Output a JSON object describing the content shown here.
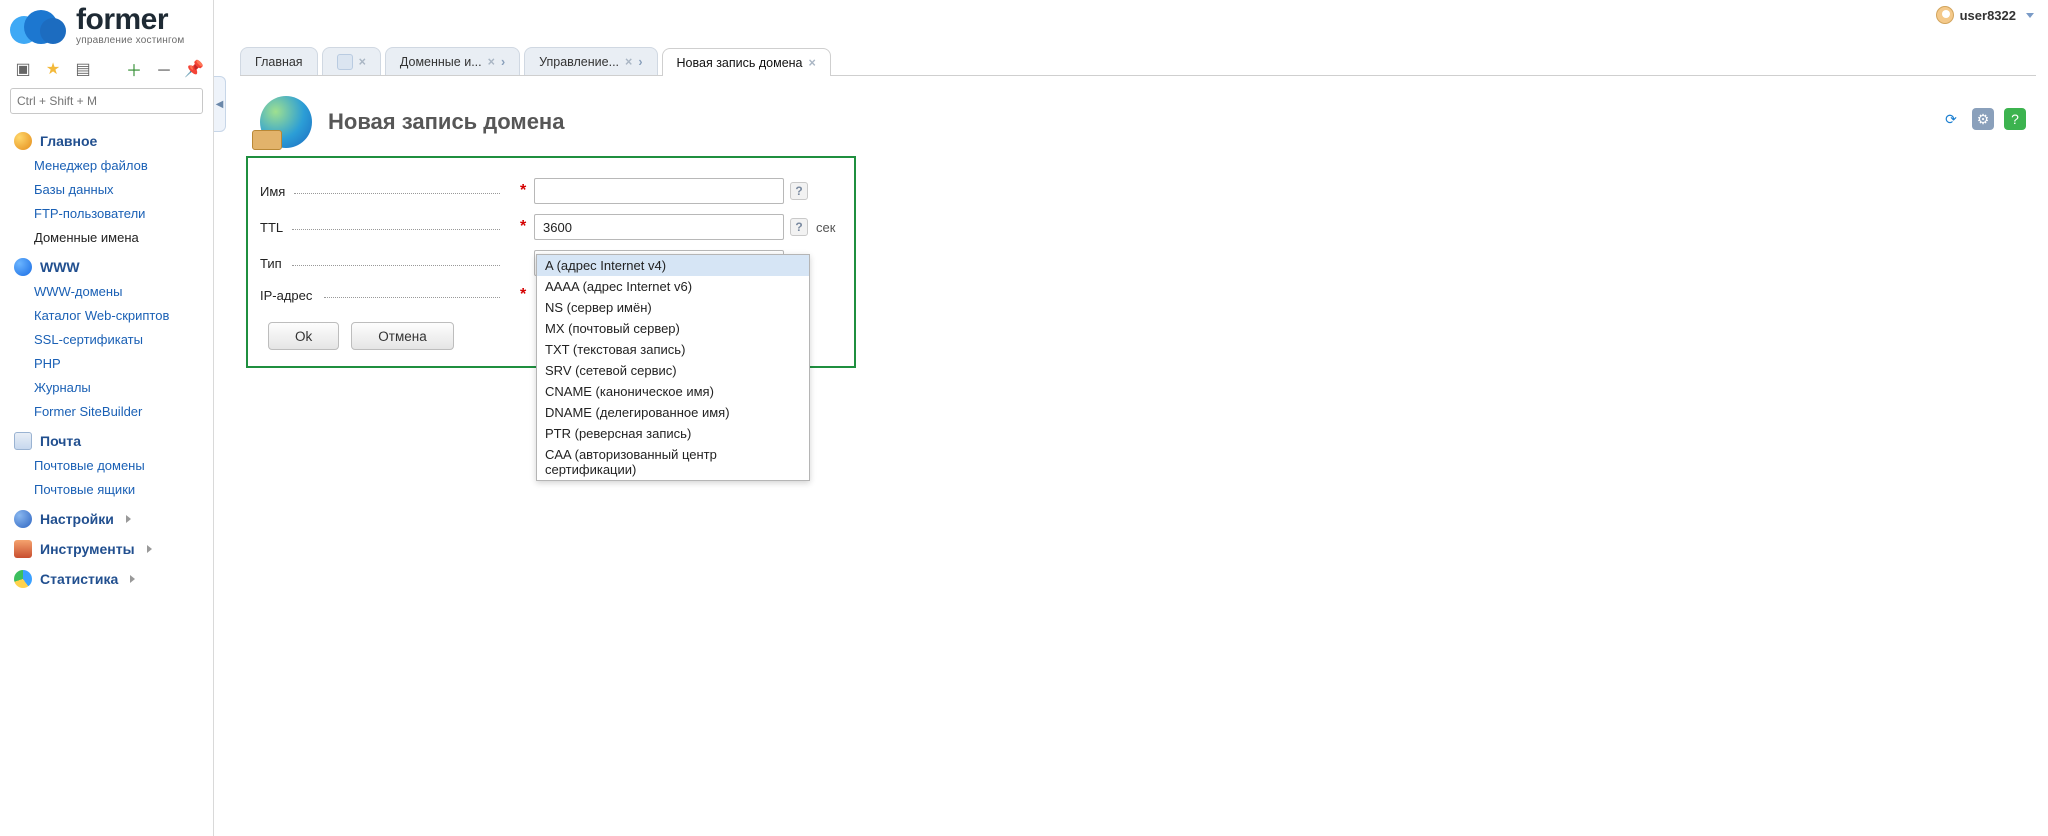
{
  "user": {
    "name": "user8322"
  },
  "logo": {
    "brand": "former",
    "tagline": "управление хостингом"
  },
  "search": {
    "placeholder": "Ctrl + Shift + M"
  },
  "sidebar": {
    "sections": [
      {
        "title": "Главное",
        "icon": "home",
        "chevron": false,
        "items": [
          "Менеджер файлов",
          "Базы данных",
          "FTP-пользователи",
          "Доменные имена"
        ],
        "current": 3
      },
      {
        "title": "WWW",
        "icon": "www",
        "chevron": false,
        "items": [
          "WWW-домены",
          "Каталог Web-скриптов",
          "SSL-сертификаты",
          "PHP",
          "Журналы",
          "Former SiteBuilder"
        ]
      },
      {
        "title": "Почта",
        "icon": "mail",
        "chevron": false,
        "items": [
          "Почтовые домены",
          "Почтовые ящики"
        ]
      },
      {
        "title": "Настройки",
        "icon": "cfg",
        "chevron": true,
        "items": []
      },
      {
        "title": "Инструменты",
        "icon": "tool",
        "chevron": true,
        "items": []
      },
      {
        "title": "Статистика",
        "icon": "stat",
        "chevron": true,
        "items": []
      }
    ]
  },
  "tabs": [
    {
      "label": "Главная",
      "kind": "text",
      "closable": false
    },
    {
      "label": "",
      "kind": "icon",
      "closable": true
    },
    {
      "label": "Доменные и...",
      "kind": "text",
      "closable": true,
      "chev": true
    },
    {
      "label": "Управление...",
      "kind": "text",
      "closable": true,
      "chev": true
    },
    {
      "label": "Новая запись домена",
      "kind": "text",
      "closable": true,
      "active": true
    }
  ],
  "page": {
    "title": "Новая запись домена"
  },
  "form": {
    "name_label": "Имя",
    "ttl_label": "TTL",
    "ttl_value": "3600",
    "ttl_unit": "сек",
    "type_label": "Тип",
    "type_value": "A (адрес Internet v4)",
    "ip_label": "IP-адрес",
    "ok": "Ok",
    "cancel": "Отмена"
  },
  "type_options": [
    "A (адрес Internet v4)",
    "AAAA (адрес Internet v6)",
    "NS (сервер имён)",
    "MX (почтовый сервер)",
    "TXT (текстовая запись)",
    "SRV (сетевой сервис)",
    "CNAME (каноническое имя)",
    "DNAME (делегированное имя)",
    "PTR (реверсная запись)",
    "CAA (авторизованный центр сертификации)"
  ]
}
